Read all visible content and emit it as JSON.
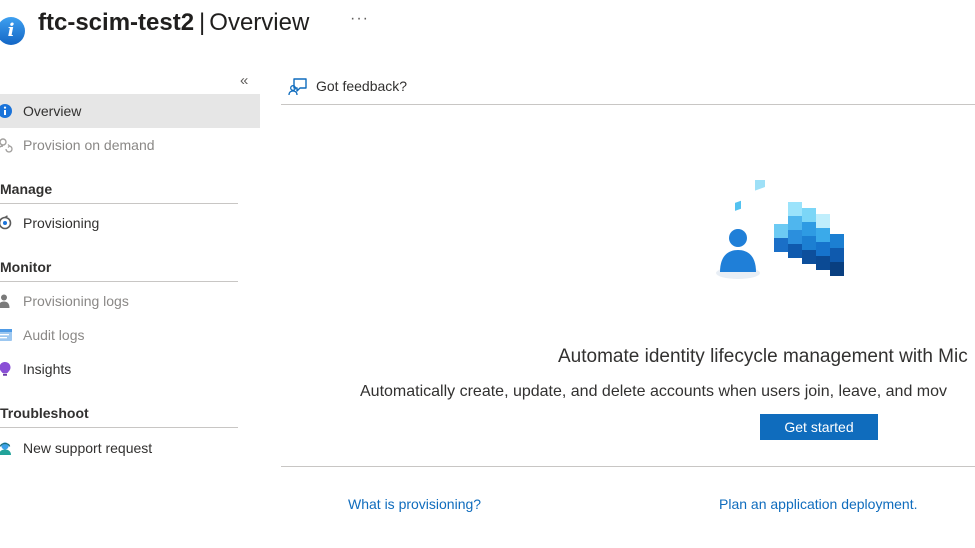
{
  "header": {
    "resource_name": "ftc-scim-test2",
    "separator": "|",
    "page_name": "Overview",
    "more_label": "···"
  },
  "sidebar": {
    "collapse_label": "«",
    "items": [
      {
        "label": "Overview",
        "icon": "info-icon",
        "state": "selected"
      },
      {
        "label": "Provision on demand",
        "icon": "provision-on-demand-icon",
        "state": "disabled"
      }
    ],
    "sections": [
      {
        "title": "Manage",
        "items": [
          {
            "label": "Provisioning",
            "icon": "provisioning-icon"
          }
        ]
      },
      {
        "title": "Monitor",
        "items": [
          {
            "label": "Provisioning logs",
            "icon": "provisioning-logs-icon",
            "state": "disabled"
          },
          {
            "label": "Audit logs",
            "icon": "audit-logs-icon",
            "state": "disabled"
          },
          {
            "label": "Insights",
            "icon": "insights-icon"
          }
        ]
      },
      {
        "title": "Troubleshoot",
        "items": [
          {
            "label": "New support request",
            "icon": "support-icon"
          }
        ]
      }
    ]
  },
  "toolbar": {
    "feedback_label": "Got feedback?"
  },
  "main": {
    "headline": "Automate identity lifecycle management with Mic",
    "description": "Automatically create, update, and delete accounts when users join, leave, and mov",
    "get_started_label": "Get started",
    "links": [
      "What is provisioning?",
      "Plan an application deployment."
    ]
  },
  "colors": {
    "accent": "#0f6cbd",
    "selected_bg": "#e6e6e6",
    "disabled_text": "#8a8886"
  }
}
